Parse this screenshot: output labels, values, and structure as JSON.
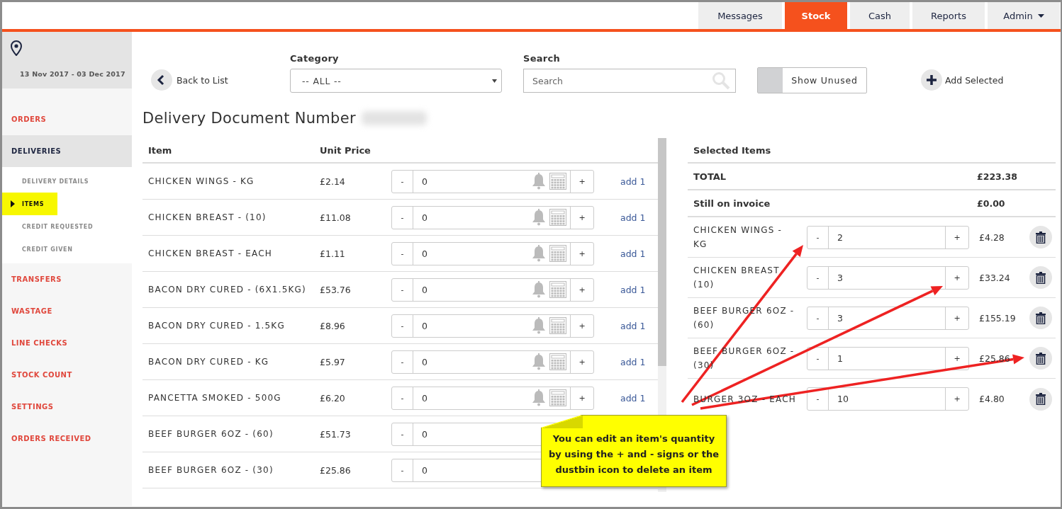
{
  "nav_tabs": [
    {
      "label": "Messages",
      "selected": false,
      "has_menu": false
    },
    {
      "label": "Stock",
      "selected": true,
      "has_menu": false
    },
    {
      "label": "Cash",
      "selected": false,
      "has_menu": false
    },
    {
      "label": "Reports",
      "selected": false,
      "has_menu": false
    },
    {
      "label": "Admin",
      "selected": false,
      "has_menu": true
    }
  ],
  "sidebar": {
    "date_range": "13 Nov 2017 - 03 Dec 2017",
    "items": [
      {
        "label": "ORDERS",
        "selected": false
      },
      {
        "label": "DELIVERIES",
        "selected": true,
        "children": [
          {
            "label": "DELIVERY DETAILS",
            "selected": false
          },
          {
            "label": "ITEMS",
            "selected": true
          },
          {
            "label": "CREDIT REQUESTED",
            "selected": false
          },
          {
            "label": "CREDIT GIVEN",
            "selected": false
          }
        ]
      },
      {
        "label": "TRANSFERS",
        "selected": false
      },
      {
        "label": "WASTAGE",
        "selected": false
      },
      {
        "label": "LINE CHECKS",
        "selected": false
      },
      {
        "label": "STOCK COUNT",
        "selected": false
      },
      {
        "label": "SETTINGS",
        "selected": false
      },
      {
        "label": "ORDERS RECEIVED",
        "selected": false
      }
    ]
  },
  "toolbar": {
    "back": "Back to List",
    "category": {
      "label": "Category",
      "value": "-- ALL --"
    },
    "search": {
      "label": "Search",
      "placeholder": "Search"
    },
    "toggle": {
      "label": "Show Unused",
      "on": false
    },
    "add": "Add Selected"
  },
  "title": "Delivery Document Number",
  "items_table": {
    "columns": [
      "Item",
      "Unit Price"
    ],
    "rows": [
      {
        "name": "CHICKEN WINGS - KG",
        "price": "£2.14",
        "minus": "-",
        "quantity": "0",
        "plus": "+",
        "add_link": "add 1"
      },
      {
        "name": "CHICKEN BREAST - (10)",
        "price": "£11.08",
        "minus": "-",
        "quantity": "0",
        "plus": "+",
        "add_link": "add 1"
      },
      {
        "name": "CHICKEN BREAST - EACH",
        "price": "£1.11",
        "minus": "-",
        "quantity": "0",
        "plus": "+",
        "add_link": "add 1"
      },
      {
        "name": "BACON DRY CURED - (6X1.5KG)",
        "price": "£53.76",
        "minus": "-",
        "quantity": "0",
        "plus": "+",
        "add_link": "add 1"
      },
      {
        "name": "BACON DRY CURED - 1.5KG",
        "price": "£8.96",
        "minus": "-",
        "quantity": "0",
        "plus": "+",
        "add_link": "add 1"
      },
      {
        "name": "BACON DRY CURED - KG",
        "price": "£5.97",
        "minus": "-",
        "quantity": "0",
        "plus": "+",
        "add_link": "add 1"
      },
      {
        "name": "PANCETTA SMOKED - 500G",
        "price": "£6.20",
        "minus": "-",
        "quantity": "0",
        "plus": "+",
        "add_link": "add 1"
      },
      {
        "name": "BEEF BURGER 6OZ - (60)",
        "price": "£51.73",
        "minus": "-",
        "quantity": "0"
      },
      {
        "name": "BEEF BURGER 6OZ - (30)",
        "price": "£25.86",
        "minus": "-",
        "quantity": "0"
      }
    ]
  },
  "selected_items": {
    "title": "Selected Items",
    "totals": [
      {
        "label": "TOTAL",
        "value": "£223.38"
      },
      {
        "label": "Still on invoice",
        "value": "£0.00"
      }
    ],
    "rows": [
      {
        "name": "CHICKEN WINGS - KG",
        "minus": "-",
        "quantity": "2",
        "plus": "+",
        "amount": "£4.28"
      },
      {
        "name": "CHICKEN BREAST (10)",
        "minus": "-",
        "quantity": "3",
        "plus": "+",
        "amount": "£33.24"
      },
      {
        "name": "BEEF BURGER 6OZ - (60)",
        "minus": "-",
        "quantity": "3",
        "plus": "+",
        "amount": "£155.19"
      },
      {
        "name": "BEEF BURGER 6OZ - (30)",
        "minus": "-",
        "quantity": "1",
        "plus": "+",
        "amount": "£25.86"
      },
      {
        "name": "BURGER 3OZ - EACH",
        "minus": "-",
        "quantity": "10",
        "plus": "+",
        "amount": "£4.80"
      }
    ]
  },
  "callout": {
    "text": "You can edit an item's quantity by using the + and - signs or the dustbin icon to delete an item"
  }
}
